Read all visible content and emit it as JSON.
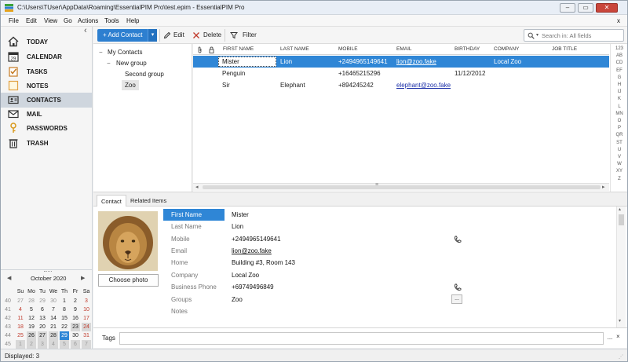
{
  "window": {
    "title": "C:\\Users\\TUser\\AppData\\Roaming\\EssentialPIM Pro\\test.epim - EssentialPIM Pro",
    "controls": [
      "–",
      "▭",
      "✕"
    ]
  },
  "menu": [
    "File",
    "Edit",
    "View",
    "Go",
    "Actions",
    "Tools",
    "Help"
  ],
  "menu_close": "x",
  "nav": [
    {
      "label": "TODAY",
      "icon": "home-icon"
    },
    {
      "label": "CALENDAR",
      "icon": "calendar-icon"
    },
    {
      "label": "TASKS",
      "icon": "tasks-icon"
    },
    {
      "label": "NOTES",
      "icon": "notes-icon"
    },
    {
      "label": "CONTACTS",
      "icon": "contacts-icon",
      "active": true
    },
    {
      "label": "MAIL",
      "icon": "mail-icon"
    },
    {
      "label": "PASSWORDS",
      "icon": "key-icon"
    },
    {
      "label": "TRASH",
      "icon": "trash-icon"
    }
  ],
  "collapse_glyph": "‹",
  "calendar": {
    "month": "October  2020",
    "prev": "◀",
    "next": "▶",
    "days": [
      "Su",
      "Mo",
      "Tu",
      "We",
      "Th",
      "Fr",
      "Sa"
    ],
    "weeks": [
      {
        "wk": "40",
        "d": [
          "27",
          "28",
          "29",
          "30",
          "1",
          "2",
          "3"
        ]
      },
      {
        "wk": "41",
        "d": [
          "4",
          "5",
          "6",
          "7",
          "8",
          "9",
          "10"
        ]
      },
      {
        "wk": "42",
        "d": [
          "11",
          "12",
          "13",
          "14",
          "15",
          "16",
          "17"
        ]
      },
      {
        "wk": "43",
        "d": [
          "18",
          "19",
          "20",
          "21",
          "22",
          "23",
          "24"
        ]
      },
      {
        "wk": "44",
        "d": [
          "25",
          "26",
          "27",
          "28",
          "29",
          "30",
          "31"
        ]
      },
      {
        "wk": "45",
        "d": [
          "1",
          "2",
          "3",
          "4",
          "5",
          "6",
          "7"
        ]
      }
    ],
    "today": "29",
    "accent": "#2f86d6"
  },
  "toolbar": {
    "add_label": "+ Add Contact",
    "add_dropdown": "▾",
    "edit_label": "Edit",
    "delete_label": "Delete",
    "filter_label": "Filter",
    "search_placeholder": "Search in: All fields"
  },
  "tree": [
    {
      "label": "My Contacts",
      "level": 0
    },
    {
      "label": "New group",
      "level": 1
    },
    {
      "label": "Second group",
      "level": 2
    },
    {
      "label": "Zoo",
      "level": 2,
      "selected": true
    }
  ],
  "tree_toggles": [
    "−",
    "−"
  ],
  "grid": {
    "header_icons": [
      "📎",
      "🔒"
    ],
    "columns": [
      "FIRST NAME",
      "LAST NAME",
      "MOBILE",
      "EMAIL",
      "BIRTHDAY",
      "COMPANY",
      "JOB TITLE"
    ],
    "rows": [
      {
        "first": "Mister",
        "last": "Lion",
        "mobile": "+2494965149641",
        "email": "lion@zoo.fake",
        "birthday": "",
        "company": "Local Zoo",
        "job": "",
        "selected": true
      },
      {
        "first": "Penguin",
        "last": "",
        "mobile": "+16465215296",
        "email": "",
        "birthday": "11/12/2012",
        "company": "",
        "job": ""
      },
      {
        "first": "Sir",
        "last": "Elephant",
        "mobile": "+894245242",
        "email": "elephant@zoo.fake",
        "birthday": "",
        "company": "",
        "job": ""
      }
    ],
    "alphabet": [
      "123",
      "AB",
      "CD",
      "EF",
      "G",
      "H",
      "IJ",
      "K",
      "L",
      "MN",
      "O",
      "P",
      "QR",
      "ST",
      "U",
      "V",
      "W",
      "XY",
      "Z"
    ],
    "scroll_thumb": "≡"
  },
  "detail": {
    "tabs": [
      "Contact",
      "Related Items"
    ],
    "choose_photo": "Choose photo",
    "fields": [
      {
        "label": "First Name",
        "value": "Mister",
        "selected": true
      },
      {
        "label": "Last Name",
        "value": "Lion"
      },
      {
        "label": "Mobile",
        "value": "+2494965149641",
        "phone": true
      },
      {
        "label": "Email",
        "value": "lion@zoo.fake",
        "link": true
      },
      {
        "label": "Home",
        "value": "Building #3, Room 143"
      },
      {
        "label": "Company",
        "value": "Local Zoo"
      },
      {
        "label": "Business Phone",
        "value": "+69749496849",
        "phone": true
      },
      {
        "label": "Groups",
        "value": "Zoo"
      },
      {
        "label": "Notes",
        "value": ""
      }
    ],
    "groups_more": "...",
    "tags_label": "Tags",
    "tags_more": "..."
  },
  "status": "Displayed: 3"
}
